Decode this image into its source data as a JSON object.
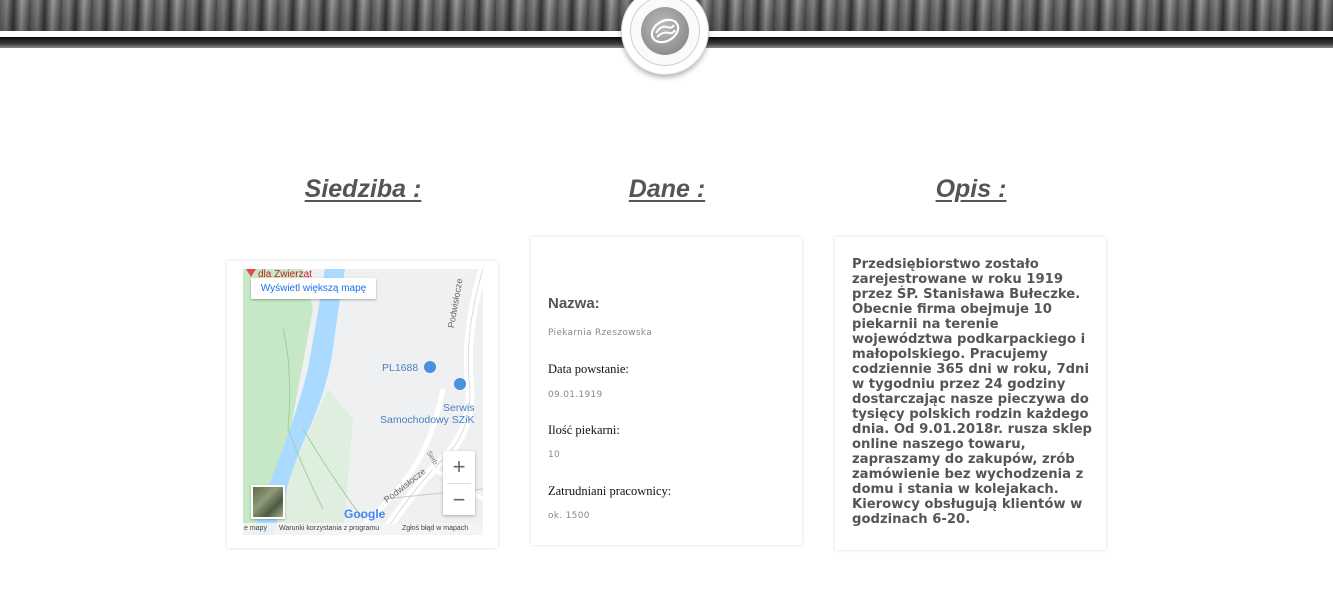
{
  "headings": {
    "siedziba": "Siedziba :",
    "dane": "Dane :",
    "opis": "Opis :"
  },
  "map": {
    "view_larger": "Wyświetl większą mapę",
    "labels": {
      "poi_top": "dla Zwierząt",
      "street_1": "Podwisłocze",
      "street_2": "Podwisłocze",
      "street_3": "Serb",
      "poi_pl": "PL1688",
      "poi_serwis_1": "Serwis",
      "poi_serwis_2": "Samochodowy SZiK"
    },
    "zoom_in": "+",
    "zoom_out": "−",
    "google": "Google",
    "footer": {
      "left": "e mapy",
      "terms": "Warunki korzystania z programu",
      "report": "Zgłoś błąd w mapach"
    }
  },
  "dane": {
    "nazwa_label": "Nazwa:",
    "nazwa_value": "Piekarnia Rzeszowska",
    "data_label": "Data powstanie:",
    "data_value": "09.01.1919",
    "ilosc_label": "Ilość piekarni:",
    "ilosc_value": "10",
    "zatrudniani_label": "Zatrudniani pracownicy:",
    "zatrudniani_value": "ok. 1500"
  },
  "opis": {
    "text": "Przedsiębiorstwo zostało zarejestrowane w roku 1919 przez ŚP. Stanisława Bułeczke. Obecnie firma obejmuje 10 piekarnii na terenie województwa podkarpackiego i małopolskiego. Pracujemy codziennie 365 dni w roku, 7dni w tygodniu przez 24 godziny dostarczając nasze pieczywa do tysięcy polskich rodzin każdego dnia. Od 9.01.2018r. rusza sklep online naszego towaru, zapraszamy do zakupów, zrób zamówienie bez wychodzenia z domu i stania w kolejakach. Kierowcy obsługują klientów w godzinach 6-20."
  },
  "colors": {
    "heading": "#555555",
    "map_water": "#aadaff",
    "map_green": "#c6e8c6",
    "map_link": "#1a73e8",
    "poi_blue": "#4a90e2"
  }
}
